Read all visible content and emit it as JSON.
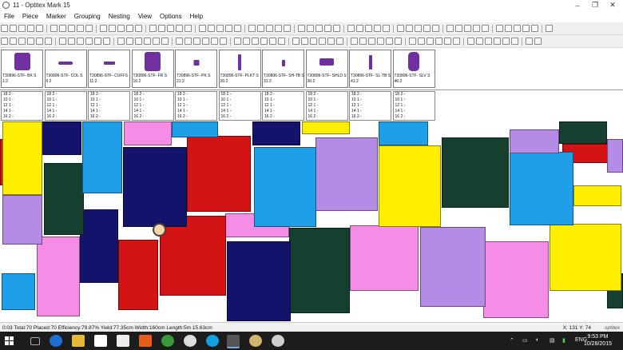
{
  "window": {
    "title": "11 - Optitex Mark 15"
  },
  "menu": [
    "File",
    "Piece",
    "Marker",
    "Grouping",
    "Nesting",
    "View",
    "Options",
    "Help"
  ],
  "pieces": [
    {
      "label": "T30896-STF- BK S",
      "count": "1:2",
      "color": "#7030a0"
    },
    {
      "label": "T30896-STF- COL S",
      "count": "6:2",
      "color": "#7030a0"
    },
    {
      "label": "T30896-STF- CUFFS",
      "count": "11:2",
      "color": "#7030a0"
    },
    {
      "label": "T30896-STF- FR S",
      "count": "16:2",
      "color": "#7030a0"
    },
    {
      "label": "T30896-STF- PK S",
      "count": "21:2",
      "color": "#7030a0"
    },
    {
      "label": "T30896-STF- PLKT S",
      "count": "26:2",
      "color": "#7030a0"
    },
    {
      "label": "T30896-STF- SH-TB S",
      "count": "31:2",
      "color": "#7030a0"
    },
    {
      "label": "T30896-STF- SHLD S",
      "count": "36:2",
      "color": "#7030a0"
    },
    {
      "label": "T30896-STF- SL-TB S",
      "count": "41:2",
      "color": "#7030a0"
    },
    {
      "label": "T30896-STF- SLV S",
      "count": "46:2",
      "color": "#7030a0"
    }
  ],
  "size_rows": [
    "18 2 -",
    "10 1 -",
    "12 1 -",
    "14 1 -",
    "16 2 -"
  ],
  "status": {
    "text": "0:03  Total:70  Placed:70  Efficiency:79.87%  Yield:77.35cm  Width:160cm  Length:5m 15.63cm",
    "coords": "X: 131  Y: 74",
    "brand": "optitex"
  },
  "taskbar": {
    "time": "9:53 PM",
    "date": "10/28/2015",
    "lang": "ENG"
  },
  "colors": {
    "yellow": "#ffee00",
    "navy": "#13136b",
    "red": "#d41414",
    "sky": "#1f9fe8",
    "lavender": "#b48ce6",
    "pink": "#f58ce6",
    "green": "#15402f",
    "purple": "#7030a0"
  }
}
